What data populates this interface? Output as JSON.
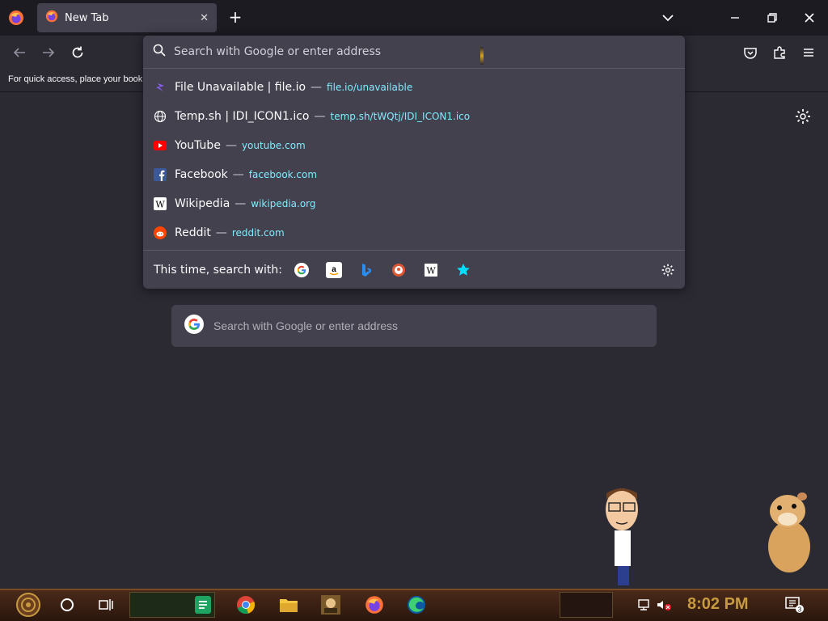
{
  "browser": {
    "tab_title": "New Tab",
    "new_tab_symbol": "+",
    "bookmarks_hint": "For quick access, place your bookmarks here on the bookmarks toolbar."
  },
  "urlbar": {
    "placeholder": "Search with Google or enter address"
  },
  "suggestions": [
    {
      "title": "File Unavailable | file.io",
      "sep": "—",
      "url": "file.io/unavailable",
      "icon": "fileio-icon"
    },
    {
      "title": "Temp.sh | IDI_ICON1.ico",
      "sep": "—",
      "url": "temp.sh/tWQtj/IDI_ICON1.ico",
      "icon": "globe-icon"
    },
    {
      "title": "YouTube",
      "sep": "—",
      "url": "youtube.com",
      "icon": "youtube-icon"
    },
    {
      "title": "Facebook",
      "sep": "—",
      "url": "facebook.com",
      "icon": "facebook-icon"
    },
    {
      "title": "Wikipedia",
      "sep": "—",
      "url": "wikipedia.org",
      "icon": "wikipedia-icon"
    },
    {
      "title": "Reddit",
      "sep": "—",
      "url": "reddit.com",
      "icon": "reddit-icon"
    }
  ],
  "oneoff": {
    "label": "This time, search with:",
    "engines": [
      "google-icon",
      "amazon-icon",
      "bing-icon",
      "duckduckgo-icon",
      "wikipedia-icon",
      "bookmarks-star-icon"
    ]
  },
  "newtab": {
    "search_placeholder": "Search with Google or enter address"
  },
  "taskbar": {
    "time": "8:02 PM",
    "notification_count": "3"
  },
  "colors": {
    "accent_url": "#80ebff",
    "popup_bg": "#42414d",
    "page_bg": "#2b2a33"
  }
}
